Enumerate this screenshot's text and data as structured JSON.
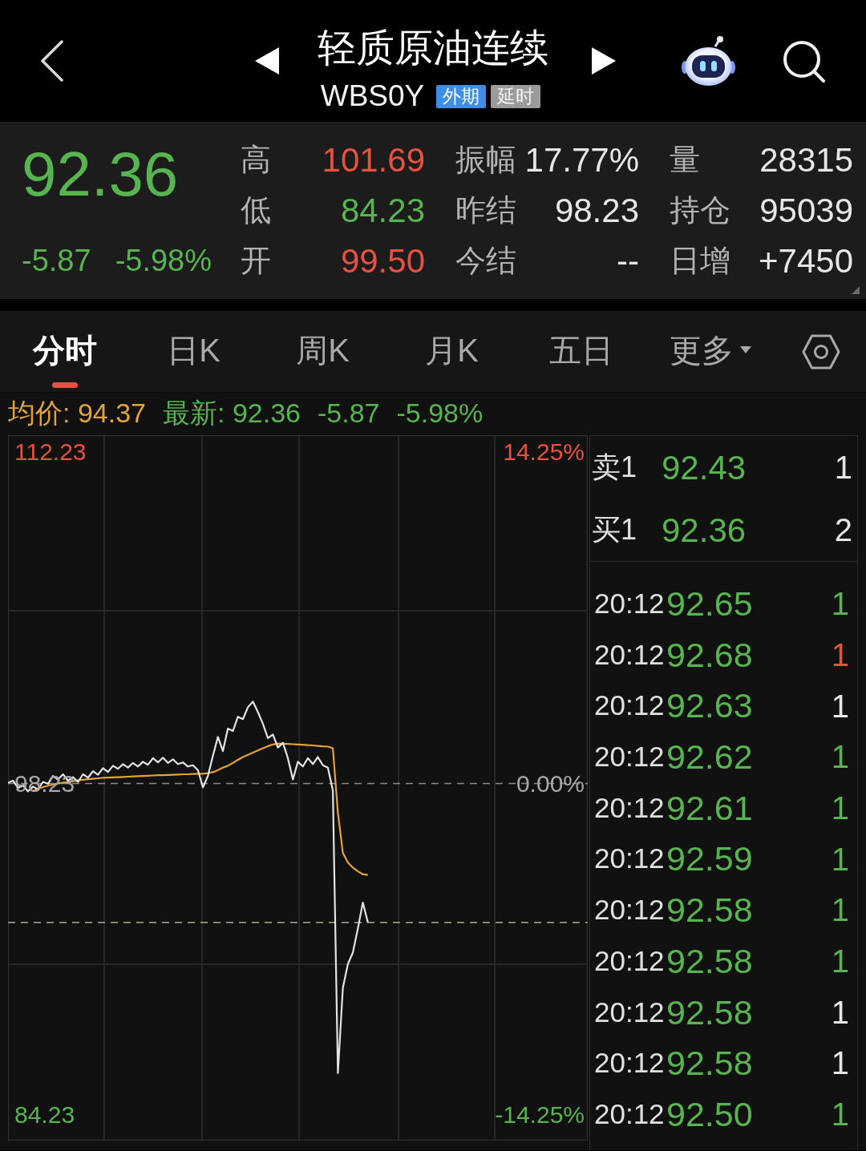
{
  "header": {
    "title": "轻质原油连续",
    "code": "WBS0Y",
    "tags": [
      {
        "text": "外期",
        "kind": "market"
      },
      {
        "text": "延时",
        "kind": "delay"
      }
    ]
  },
  "quote": {
    "price": "92.36",
    "change": "-5.87",
    "change_pct": "-5.98%",
    "color": "#58b450",
    "stats": [
      {
        "label": "高",
        "value": "101.69",
        "color": "#e8503f"
      },
      {
        "label": "振幅",
        "value": "17.77%",
        "color": "#e6e6e6"
      },
      {
        "label": "量",
        "value": "28315",
        "color": "#e6e6e6"
      },
      {
        "label": "低",
        "value": "84.23",
        "color": "#58b450"
      },
      {
        "label": "昨结",
        "value": "98.23",
        "color": "#e6e6e6"
      },
      {
        "label": "持仓",
        "value": "95039",
        "color": "#e6e6e6"
      },
      {
        "label": "开",
        "value": "99.50",
        "color": "#e8503f"
      },
      {
        "label": "今结",
        "value": "--",
        "color": "#e6e6e6"
      },
      {
        "label": "日增",
        "value": "+7450",
        "color": "#e6e6e6"
      }
    ]
  },
  "chart_tabs": [
    {
      "label": "分时",
      "selected": true,
      "kind": "tab"
    },
    {
      "label": "日K",
      "selected": false,
      "kind": "tab"
    },
    {
      "label": "周K",
      "selected": false,
      "kind": "tab"
    },
    {
      "label": "月K",
      "selected": false,
      "kind": "tab"
    },
    {
      "label": "五日",
      "selected": false,
      "kind": "tab"
    },
    {
      "label": "更多",
      "selected": false,
      "kind": "menu"
    }
  ],
  "info_line": [
    {
      "text": "均价: 94.37",
      "color": "#e0a43c"
    },
    {
      "text": "最新: 92.36",
      "color": "#58b450"
    },
    {
      "text": "-5.87",
      "color": "#58b450"
    },
    {
      "text": "-5.98%",
      "color": "#58b450"
    }
  ],
  "chart": {
    "chart_data": {
      "type": "line",
      "ylim": [
        83.15,
        112.94
      ],
      "yticks": [
        {
          "value": 112.23,
          "label": "112.23"
        },
        {
          "value": 98.23,
          "label": "98.23"
        },
        {
          "value": 84.23,
          "label": "84.23"
        }
      ],
      "series": [
        {
          "color": "#e4e4e4",
          "values": [
            98.26,
            98.35,
            98.05,
            98.15,
            97.9,
            98.1,
            97.98,
            98.3,
            98.22,
            98.55,
            98.4,
            98.62,
            98.35,
            98.5,
            98.3,
            98.62,
            98.48,
            98.75,
            98.6,
            98.88,
            98.72,
            98.98,
            98.85,
            99.05,
            98.9,
            99.1,
            98.95,
            99.15,
            99.02,
            99.3,
            99.12,
            99.32,
            99.1,
            99.25,
            99.05,
            99.12,
            98.95,
            99.0,
            98.8,
            98.07,
            98.55,
            99.4,
            100.2,
            99.6,
            100.55,
            100.45,
            101.05,
            100.95,
            101.45,
            101.69,
            101.25,
            100.75,
            100.15,
            100.3,
            99.75,
            99.95,
            99.3,
            98.4,
            99.15,
            98.95,
            99.3,
            99.05,
            99.35,
            99.0,
            98.9,
            97.94,
            86.0,
            89.6,
            90.6,
            91.1,
            92.1,
            93.2,
            92.36,
            null,
            null,
            null,
            null,
            null,
            null,
            null,
            null,
            null,
            null,
            null,
            null,
            null,
            null,
            null,
            null,
            null,
            null,
            null,
            null,
            null,
            null,
            null,
            null,
            null,
            null,
            null,
            null,
            null,
            null,
            null,
            null,
            null,
            null,
            null,
            null,
            null,
            null,
            null,
            null,
            null,
            null,
            null,
            null
          ]
        },
        {
          "color": "#e3a23a",
          "values": [
            null,
            null,
            null,
            null,
            null,
            97.92,
            98.0,
            98.08,
            98.14,
            98.19,
            98.23,
            98.27,
            98.3,
            98.33,
            98.36,
            98.39,
            98.41,
            98.43,
            98.45,
            98.47,
            98.48,
            98.49,
            98.5,
            98.51,
            98.52,
            98.53,
            98.54,
            98.55,
            98.56,
            98.57,
            98.58,
            98.58,
            98.59,
            98.6,
            98.61,
            98.62,
            98.62,
            98.63,
            98.64,
            98.64,
            98.67,
            98.71,
            98.8,
            98.9,
            98.98,
            99.1,
            99.23,
            99.35,
            99.44,
            99.53,
            99.63,
            99.72,
            99.81,
            99.88,
            99.92,
            99.91,
            99.9,
            99.89,
            99.88,
            99.87,
            99.85,
            99.84,
            99.82,
            99.8,
            99.79,
            99.72,
            97.0,
            95.3,
            94.9,
            94.68,
            94.52,
            94.4,
            94.37,
            null,
            null,
            null,
            null,
            null,
            null,
            null,
            null,
            null,
            null,
            null,
            null,
            null,
            null,
            null,
            null,
            null,
            null,
            null,
            null,
            null,
            null,
            null,
            null,
            null,
            null,
            null,
            null,
            null,
            null,
            null,
            null,
            null,
            null,
            null,
            null,
            null,
            null,
            null,
            null,
            null,
            null,
            null,
            null
          ]
        }
      ],
      "ref_lines": [
        {
          "axis": "y",
          "value": 98.23,
          "color": "#8a8a8a"
        },
        {
          "axis": "y",
          "value": 92.36,
          "color": "#9a9484"
        }
      ]
    },
    "right_labels": [
      {
        "text": "14.25%",
        "color": "#e8503f"
      },
      {
        "text": "0.00%",
        "color": "#a8a8a8"
      },
      {
        "text": "-14.25%",
        "color": "#58b450"
      }
    ]
  },
  "order_book": [
    {
      "label": "卖1",
      "price": "92.43",
      "volume": "1"
    },
    {
      "label": "买1",
      "price": "92.36",
      "volume": "2"
    }
  ],
  "trades": [
    {
      "time": "20:12",
      "price": "92.65",
      "volume": "1",
      "color": "#58b450"
    },
    {
      "time": "20:12",
      "price": "92.68",
      "volume": "1",
      "color": "#e8503f"
    },
    {
      "time": "20:12",
      "price": "92.63",
      "volume": "1",
      "color": "#e6e6e6"
    },
    {
      "time": "20:12",
      "price": "92.62",
      "volume": "1",
      "color": "#58b450"
    },
    {
      "time": "20:12",
      "price": "92.61",
      "volume": "1",
      "color": "#58b450"
    },
    {
      "time": "20:12",
      "price": "92.59",
      "volume": "1",
      "color": "#58b450"
    },
    {
      "time": "20:12",
      "price": "92.58",
      "volume": "1",
      "color": "#58b450"
    },
    {
      "time": "20:12",
      "price": "92.58",
      "volume": "1",
      "color": "#58b450"
    },
    {
      "time": "20:12",
      "price": "92.58",
      "volume": "1",
      "color": "#e6e6e6"
    },
    {
      "time": "20:12",
      "price": "92.58",
      "volume": "1",
      "color": "#e6e6e6"
    },
    {
      "time": "20:12",
      "price": "92.50",
      "volume": "1",
      "color": "#58b450"
    }
  ]
}
